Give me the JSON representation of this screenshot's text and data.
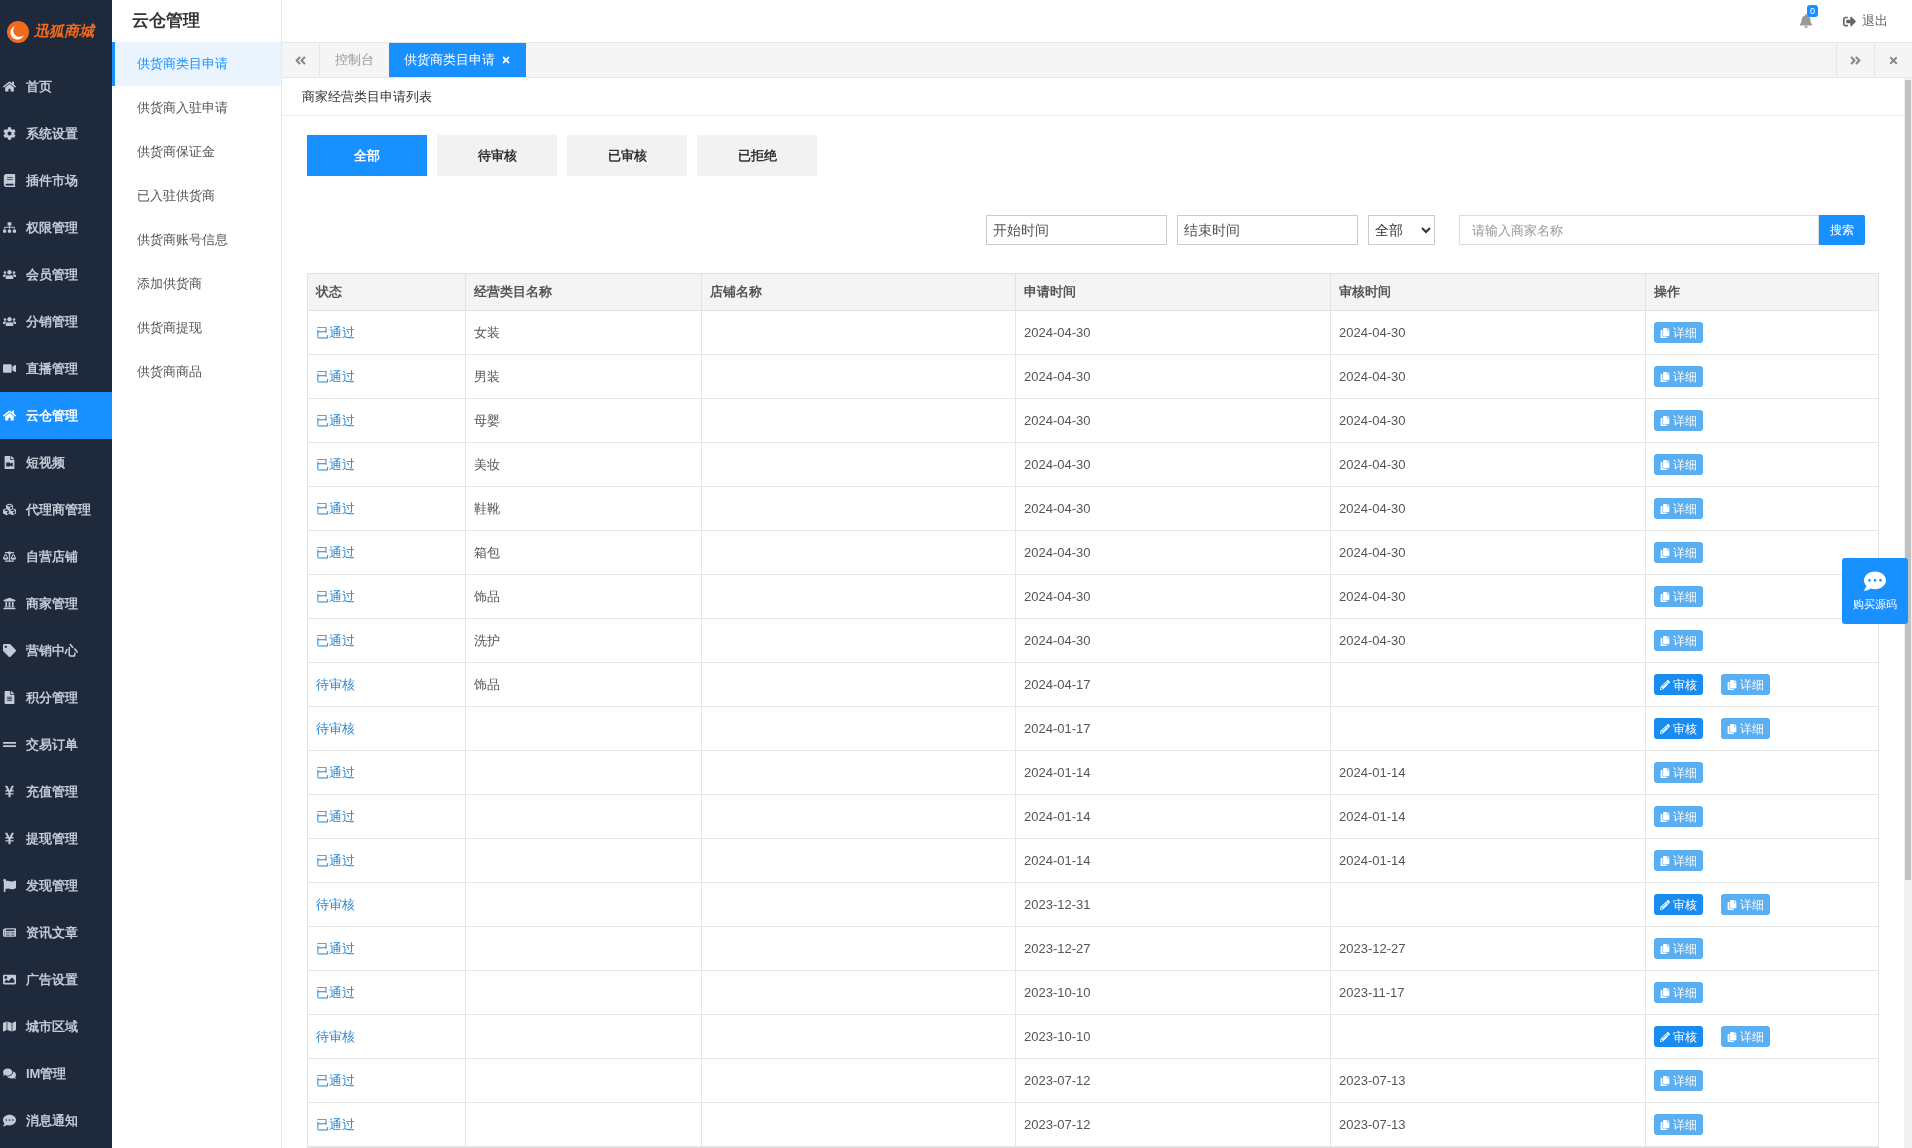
{
  "logo": {
    "text": "迅狐商城"
  },
  "sidebar": {
    "items": [
      {
        "label": "首页",
        "selected": false
      },
      {
        "label": "系统设置",
        "selected": false
      },
      {
        "label": "插件市场",
        "selected": false
      },
      {
        "label": "权限管理",
        "selected": false
      },
      {
        "label": "会员管理",
        "selected": false
      },
      {
        "label": "分销管理",
        "selected": false
      },
      {
        "label": "直播管理",
        "selected": false
      },
      {
        "label": "云仓管理",
        "selected": true
      },
      {
        "label": "短视频",
        "selected": false
      },
      {
        "label": "代理商管理",
        "selected": false
      },
      {
        "label": "自营店铺",
        "selected": false
      },
      {
        "label": "商家管理",
        "selected": false
      },
      {
        "label": "营销中心",
        "selected": false
      },
      {
        "label": "积分管理",
        "selected": false
      },
      {
        "label": "交易订单",
        "selected": false
      },
      {
        "label": "充值管理",
        "selected": false
      },
      {
        "label": "提现管理",
        "selected": false
      },
      {
        "label": "发现管理",
        "selected": false
      },
      {
        "label": "资讯文章",
        "selected": false
      },
      {
        "label": "广告设置",
        "selected": false
      },
      {
        "label": "城市区域",
        "selected": false
      },
      {
        "label": "IM管理",
        "selected": false
      },
      {
        "label": "消息通知",
        "selected": false
      }
    ]
  },
  "submenu": {
    "title": "云仓管理",
    "items": [
      {
        "label": "供货商类目申请",
        "selected": true
      },
      {
        "label": "供货商入驻申请",
        "selected": false
      },
      {
        "label": "供货商保证金",
        "selected": false
      },
      {
        "label": "已入驻供货商",
        "selected": false
      },
      {
        "label": "供货商账号信息",
        "selected": false
      },
      {
        "label": "添加供货商",
        "selected": false
      },
      {
        "label": "供货商提现",
        "selected": false
      },
      {
        "label": "供货商商品",
        "selected": false
      }
    ]
  },
  "header": {
    "notification_count": "0",
    "logout": "退出"
  },
  "page_tabs": [
    {
      "label": "控制台",
      "selected": false
    },
    {
      "label": "供货商类目申请",
      "selected": true
    }
  ],
  "panel": {
    "title": "商家经营类目申请列表"
  },
  "filter_tabs": [
    {
      "label": "全部",
      "selected": true
    },
    {
      "label": "待审核",
      "selected": false
    },
    {
      "label": "已审核",
      "selected": false
    },
    {
      "label": "已拒绝",
      "selected": false
    }
  ],
  "search": {
    "start_placeholder": "开始时间",
    "end_placeholder": "结束时间",
    "status_select": "全部",
    "name_placeholder": "请输入商家名称",
    "button": "搜索"
  },
  "table": {
    "columns": [
      "状态",
      "经营类目名称",
      "店铺名称",
      "申请时间",
      "审核时间",
      "操作"
    ],
    "rows": [
      {
        "status": "已通过",
        "category": "女装",
        "shop": "",
        "applied": "2024-04-30",
        "reviewed": "2024-04-30",
        "actions": [
          {
            "kind": "detail",
            "label": "详细"
          }
        ]
      },
      {
        "status": "已通过",
        "category": "男装",
        "shop": "",
        "applied": "2024-04-30",
        "reviewed": "2024-04-30",
        "actions": [
          {
            "kind": "detail",
            "label": "详细"
          }
        ]
      },
      {
        "status": "已通过",
        "category": "母婴",
        "shop": "",
        "applied": "2024-04-30",
        "reviewed": "2024-04-30",
        "actions": [
          {
            "kind": "detail",
            "label": "详细"
          }
        ]
      },
      {
        "status": "已通过",
        "category": "美妆",
        "shop": "",
        "applied": "2024-04-30",
        "reviewed": "2024-04-30",
        "actions": [
          {
            "kind": "detail",
            "label": "详细"
          }
        ]
      },
      {
        "status": "已通过",
        "category": "鞋靴",
        "shop": "",
        "applied": "2024-04-30",
        "reviewed": "2024-04-30",
        "actions": [
          {
            "kind": "detail",
            "label": "详细"
          }
        ]
      },
      {
        "status": "已通过",
        "category": "箱包",
        "shop": "",
        "applied": "2024-04-30",
        "reviewed": "2024-04-30",
        "actions": [
          {
            "kind": "detail",
            "label": "详细"
          }
        ]
      },
      {
        "status": "已通过",
        "category": "饰品",
        "shop": "",
        "applied": "2024-04-30",
        "reviewed": "2024-04-30",
        "actions": [
          {
            "kind": "detail",
            "label": "详细"
          }
        ]
      },
      {
        "status": "已通过",
        "category": "洗护",
        "shop": "",
        "applied": "2024-04-30",
        "reviewed": "2024-04-30",
        "actions": [
          {
            "kind": "detail",
            "label": "详细"
          }
        ]
      },
      {
        "status": "待审核",
        "category": "饰品",
        "shop": "",
        "applied": "2024-04-17",
        "reviewed": "",
        "actions": [
          {
            "kind": "review",
            "label": "审核"
          },
          {
            "kind": "detail",
            "label": "详细"
          }
        ]
      },
      {
        "status": "待审核",
        "category": "",
        "shop": "",
        "applied": "2024-01-17",
        "reviewed": "",
        "actions": [
          {
            "kind": "review",
            "label": "审核"
          },
          {
            "kind": "detail",
            "label": "详细"
          }
        ]
      },
      {
        "status": "已通过",
        "category": "",
        "shop": "",
        "applied": "2024-01-14",
        "reviewed": "2024-01-14",
        "actions": [
          {
            "kind": "detail",
            "label": "详细"
          }
        ]
      },
      {
        "status": "已通过",
        "category": "",
        "shop": "",
        "applied": "2024-01-14",
        "reviewed": "2024-01-14",
        "actions": [
          {
            "kind": "detail",
            "label": "详细"
          }
        ]
      },
      {
        "status": "已通过",
        "category": "",
        "shop": "",
        "applied": "2024-01-14",
        "reviewed": "2024-01-14",
        "actions": [
          {
            "kind": "detail",
            "label": "详细"
          }
        ]
      },
      {
        "status": "待审核",
        "category": "",
        "shop": "",
        "applied": "2023-12-31",
        "reviewed": "",
        "actions": [
          {
            "kind": "review",
            "label": "审核"
          },
          {
            "kind": "detail",
            "label": "详细"
          }
        ]
      },
      {
        "status": "已通过",
        "category": "",
        "shop": "",
        "applied": "2023-12-27",
        "reviewed": "2023-12-27",
        "actions": [
          {
            "kind": "detail",
            "label": "详细"
          }
        ]
      },
      {
        "status": "已通过",
        "category": "",
        "shop": "",
        "applied": "2023-10-10",
        "reviewed": "2023-11-17",
        "actions": [
          {
            "kind": "detail",
            "label": "详细"
          }
        ]
      },
      {
        "status": "待审核",
        "category": "",
        "shop": "",
        "applied": "2023-10-10",
        "reviewed": "",
        "actions": [
          {
            "kind": "review",
            "label": "审核"
          },
          {
            "kind": "detail",
            "label": "详细"
          }
        ]
      },
      {
        "status": "已通过",
        "category": "",
        "shop": "",
        "applied": "2023-07-12",
        "reviewed": "2023-07-13",
        "actions": [
          {
            "kind": "detail",
            "label": "详细"
          }
        ]
      },
      {
        "status": "已通过",
        "category": "",
        "shop": "",
        "applied": "2023-07-12",
        "reviewed": "2023-07-13",
        "actions": [
          {
            "kind": "detail",
            "label": "详细"
          }
        ]
      }
    ]
  },
  "float_button": {
    "label": "购买源码"
  }
}
